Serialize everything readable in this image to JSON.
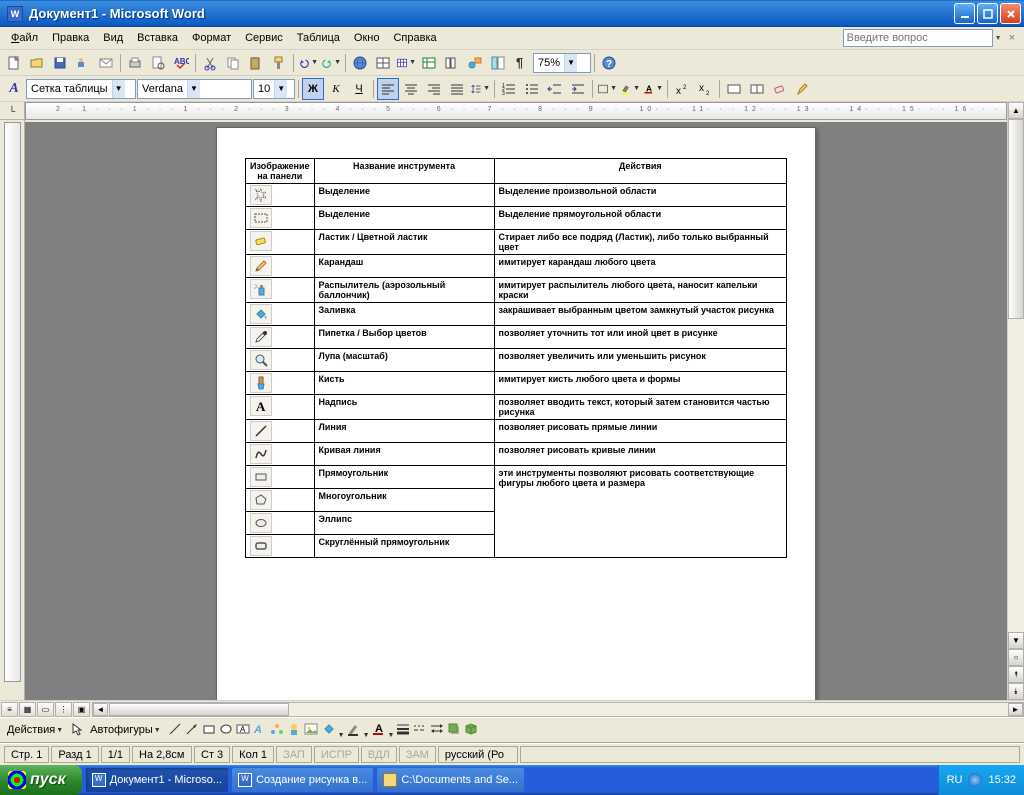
{
  "titlebar": {
    "title": "Документ1 - Microsoft Word",
    "app_icon": "W"
  },
  "menubar": {
    "items": [
      "Файл",
      "Правка",
      "Вид",
      "Вставка",
      "Формат",
      "Сервис",
      "Таблица",
      "Окно",
      "Справка"
    ],
    "help_placeholder": "Введите вопрос"
  },
  "toolbar1": {
    "zoom": "75%"
  },
  "toolbar2": {
    "style_icon": "A",
    "style": "Сетка таблицы",
    "font": "Verdana",
    "size": "10"
  },
  "ruler_marks": "2 · 1 · · · 1 · · · 1 · · · 2 · · · 3 · · · 4 · · · 5 · · · 6 · · · 7 · · · 8 · · · 9 · · · 10· · · 11· · · 12· · · 13· · · 14· · · 15· · · 16· · · 17· ·",
  "doc": {
    "headers": [
      "Изображение на панели",
      "Название инструмента",
      "Действия"
    ],
    "rows": [
      {
        "icon": "star",
        "name": "Выделение",
        "action": "Выделение произвольной области"
      },
      {
        "icon": "rect-sel",
        "name": "Выделение",
        "action": "Выделение прямоугольной области"
      },
      {
        "icon": "eraser",
        "name": "Ластик / Цветной ластик",
        "action": "Стирает либо все подряд (Ластик), либо только выбранный цвет"
      },
      {
        "icon": "pencil",
        "name": "Карандаш",
        "action": "имитирует карандаш любого цвета"
      },
      {
        "icon": "spray",
        "name": "Распылитель (аэрозольный баллончик)",
        "action": "имитирует распылитель любого цвета, наносит капельки краски"
      },
      {
        "icon": "fill",
        "name": "Заливка",
        "action": "закрашивает выбранным цветом замкнутый участок рисунка"
      },
      {
        "icon": "picker",
        "name": "Пипетка / Выбор цветов",
        "action": "позволяет уточнить тот или иной цвет в рисунке"
      },
      {
        "icon": "zoom",
        "name": "Лупа (масштаб)",
        "action": "позволяет увеличить или уменьшить рисунок"
      },
      {
        "icon": "brush",
        "name": "Кисть",
        "action": "имитирует кисть любого цвета и формы"
      },
      {
        "icon": "text",
        "name": "Надпись",
        "action": "позволяет вводить текст, который затем становится частью рисунка"
      },
      {
        "icon": "line",
        "name": "Линия",
        "action": "позволяет рисовать прямые линии"
      },
      {
        "icon": "curve",
        "name": "Кривая линия",
        "action": "позволяет рисовать кривые линии"
      },
      {
        "icon": "rect",
        "name": "Прямоугольник",
        "action": "эти инструменты позволяют рисовать соответствующие фигуры любого цвета и размера",
        "rowspan": 4
      },
      {
        "icon": "polygon",
        "name": "Многоугольник"
      },
      {
        "icon": "ellipse",
        "name": "Эллипс"
      },
      {
        "icon": "round-rect",
        "name": "Скруглённый прямоугольник"
      }
    ]
  },
  "drawbar": {
    "actions": "Действия",
    "autoshapes": "Автофигуры"
  },
  "statusbar": {
    "page": "Стр. 1",
    "section": "Разд 1",
    "pages": "1/1",
    "at": "На 2,8см",
    "line": "Ст 3",
    "col": "Кол 1",
    "rec": "ЗАП",
    "fix": "ИСПР",
    "ext": "ВДЛ",
    "ovr": "ЗАМ",
    "lang": "русский (Ро"
  },
  "taskbar": {
    "start": "пуск",
    "tasks": [
      "Документ1 - Microso...",
      "Создание рисунка в...",
      "C:\\Documents and Se..."
    ],
    "lang": "RU",
    "time": "15:32"
  }
}
